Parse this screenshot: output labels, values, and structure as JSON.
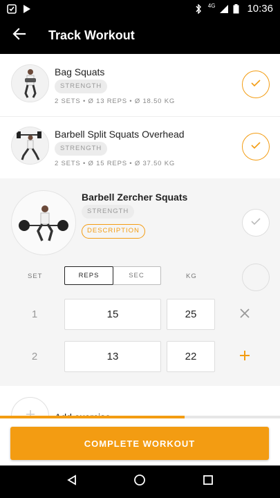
{
  "status_bar": {
    "time": "10:36",
    "network": "4G",
    "icons": [
      "notification-check-icon",
      "play-store-icon",
      "bluetooth-icon",
      "signal-icon",
      "battery-icon"
    ]
  },
  "app_bar": {
    "title": "Track Workout",
    "back_icon": "arrow-back-icon"
  },
  "exercises": [
    {
      "name": "Bag Squats",
      "category": "STRENGTH",
      "summary": "2 SETS  •  Ø 13 REPS  •  Ø 18.50 KG",
      "completed": true
    },
    {
      "name": "Barbell Split Squats Overhead",
      "category": "STRENGTH",
      "summary": "2 SETS  •  Ø 15 REPS  •  Ø 37.50 KG",
      "completed": true
    },
    {
      "name": "Barbell Zercher Squats",
      "category": "STRENGTH",
      "description_label": "DESCRIPTION",
      "completed": false
    }
  ],
  "set_table": {
    "headers": {
      "set": "SET",
      "weight": "KG"
    },
    "mode_options": [
      "REPS",
      "SEC"
    ],
    "active_mode": "REPS",
    "rows": [
      {
        "set": "1",
        "reps": "15",
        "kg": "25",
        "action": "remove-icon"
      },
      {
        "set": "2",
        "reps": "13",
        "kg": "22",
        "action": "add-icon"
      }
    ]
  },
  "add_exercise": {
    "label": "Add exercise"
  },
  "progress": {
    "fraction": 0.66
  },
  "complete_button": {
    "label": "COMPLETE WORKOUT"
  },
  "colors": {
    "accent": "#f39c12",
    "bar": "#000000",
    "chip_bg": "#ececec"
  }
}
